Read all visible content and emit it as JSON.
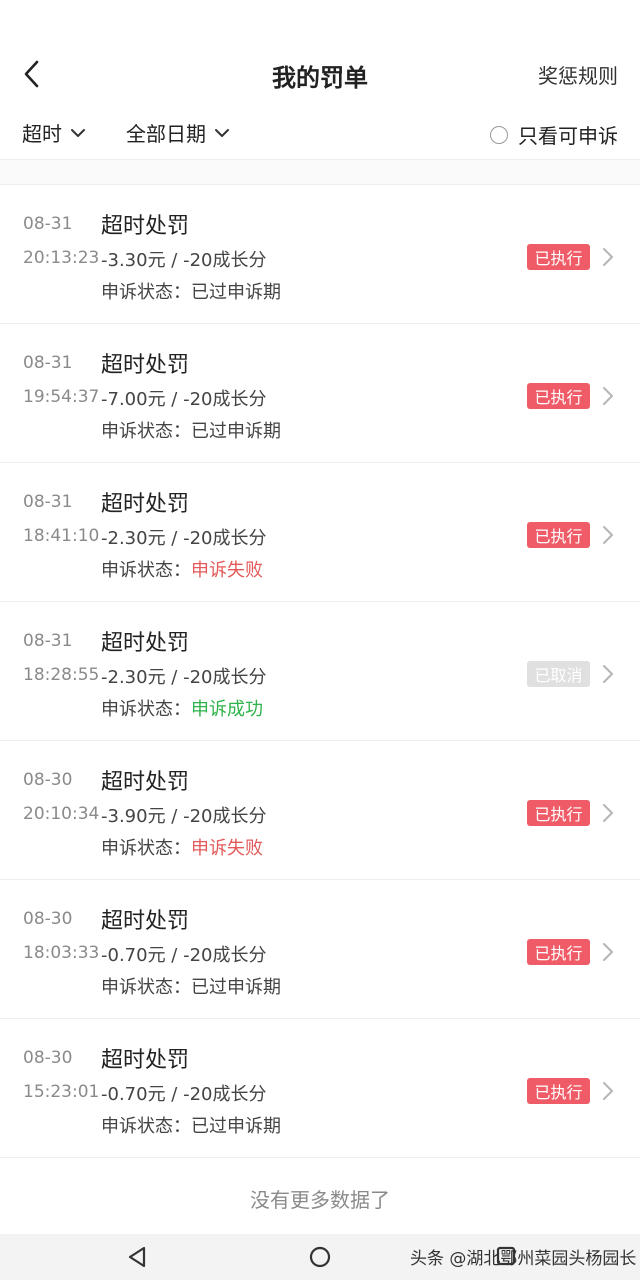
{
  "header": {
    "title": "我的罚单",
    "rules_link": "奖惩规则"
  },
  "filters": {
    "type_label": "超时",
    "date_label": "全部日期",
    "appeal_only_label": "只看可申诉"
  },
  "status_prefix": "申诉状态：",
  "records": [
    {
      "date": "08-31",
      "time": "20:13:23",
      "title": "超时处罚",
      "amount": "-3.30元 / -20成长分",
      "appeal_status": "已过申诉期",
      "status_color": "normal",
      "badge": "已执行",
      "badge_type": "exec"
    },
    {
      "date": "08-31",
      "time": "19:54:37",
      "title": "超时处罚",
      "amount": "-7.00元 / -20成长分",
      "appeal_status": "已过申诉期",
      "status_color": "normal",
      "badge": "已执行",
      "badge_type": "exec"
    },
    {
      "date": "08-31",
      "time": "18:41:10",
      "title": "超时处罚",
      "amount": "-2.30元 / -20成长分",
      "appeal_status": "申诉失败",
      "status_color": "red",
      "badge": "已执行",
      "badge_type": "exec"
    },
    {
      "date": "08-31",
      "time": "18:28:55",
      "title": "超时处罚",
      "amount": "-2.30元 / -20成长分",
      "appeal_status": "申诉成功",
      "status_color": "green",
      "badge": "已取消",
      "badge_type": "cancel"
    },
    {
      "date": "08-30",
      "time": "20:10:34",
      "title": "超时处罚",
      "amount": "-3.90元 / -20成长分",
      "appeal_status": "申诉失败",
      "status_color": "red",
      "badge": "已执行",
      "badge_type": "exec"
    },
    {
      "date": "08-30",
      "time": "18:03:33",
      "title": "超时处罚",
      "amount": "-0.70元 / -20成长分",
      "appeal_status": "已过申诉期",
      "status_color": "normal",
      "badge": "已执行",
      "badge_type": "exec"
    },
    {
      "date": "08-30",
      "time": "15:23:01",
      "title": "超时处罚",
      "amount": "-0.70元 / -20成长分",
      "appeal_status": "已过申诉期",
      "status_color": "normal",
      "badge": "已执行",
      "badge_type": "exec"
    }
  ],
  "footer": {
    "no_more": "没有更多数据了"
  },
  "watermark": "头条 @湖北鄂州菜园头杨园长",
  "colors": {
    "exec_badge": "#ef5c67",
    "cancel_badge": "#e0e0e0",
    "status_red": "#e45a5a",
    "status_green": "#2fb34a"
  },
  "icons": {
    "back": "chevron-left-icon",
    "dropdown": "chevron-down-icon",
    "row_arrow": "chevron-right-icon",
    "nav_back": "triangle-back-icon",
    "nav_home": "circle-home-icon"
  }
}
